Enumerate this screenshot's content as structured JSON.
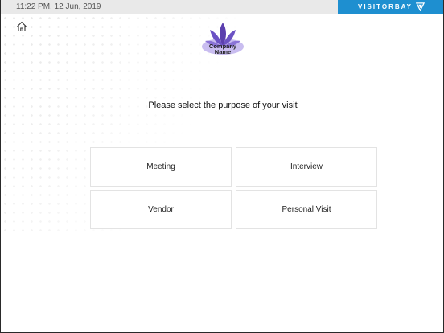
{
  "status_bar": {
    "datetime": "11:22 PM, 12 Jun, 2019",
    "brand_text": "VISITORBAY"
  },
  "header": {
    "home_icon": "home-icon",
    "logo_text_line1": "Company",
    "logo_text_line2": "Name"
  },
  "main": {
    "prompt": "Please select the purpose of your visit",
    "options": [
      {
        "label": "Meeting"
      },
      {
        "label": "Interview"
      },
      {
        "label": "Vendor"
      },
      {
        "label": "Personal Visit"
      }
    ]
  },
  "colors": {
    "brand_blue": "#1e8fd0",
    "logo_purple_dark": "#5b3fae",
    "logo_purple_light": "#b8a6e8"
  }
}
